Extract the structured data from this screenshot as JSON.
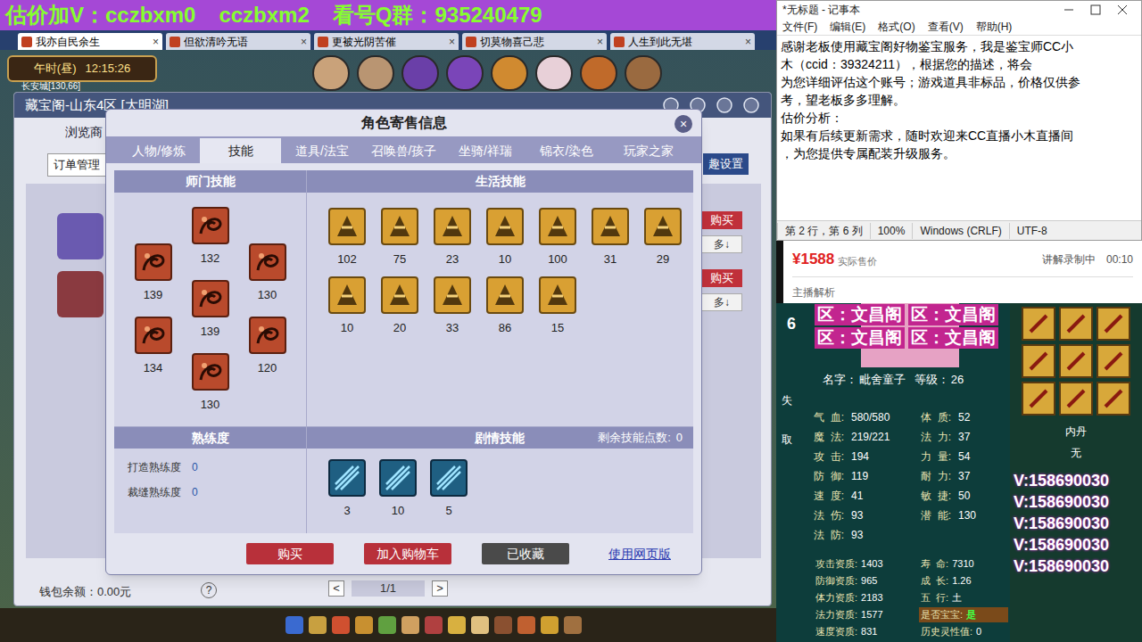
{
  "banner": {
    "label1": "估价加V：",
    "v1": "cczbxm0",
    "v2": "cczbxm2",
    "label2": "看号Q群：",
    "qq": "935240479"
  },
  "browser_tabs": [
    {
      "label": "我亦自民余生",
      "selected": true
    },
    {
      "label": "但欲清吟无语",
      "selected": false
    },
    {
      "label": "更被光阴苦催",
      "selected": false
    },
    {
      "label": "切莫物喜己悲",
      "selected": false
    },
    {
      "label": "人生到此无堪",
      "selected": false
    }
  ],
  "browser_tab_close": "×",
  "game_hud": {
    "period": "午时(昼)",
    "clock": "12:15:26",
    "location": "长安城[130,66]"
  },
  "cbg_window": {
    "title": "藏宝阁-山东4区 [大明湖]",
    "nav": "浏览商",
    "orders": "订单管理",
    "interest": "趣设置",
    "list_buttons": [
      {
        "buy": "购买",
        "more": "多↓"
      },
      {
        "buy": "购买",
        "more": "多↓"
      }
    ],
    "wallet": "钱包余额：0.00元",
    "help": "?",
    "prev": "<",
    "page": "1/1",
    "next": ">"
  },
  "dialog": {
    "title": "角色寄售信息",
    "close": "×",
    "tabs": [
      {
        "label": "人物/修炼",
        "selected": false
      },
      {
        "label": "技能",
        "selected": true
      },
      {
        "label": "道具/法宝",
        "selected": false
      },
      {
        "label": "召唤兽/孩子",
        "selected": false
      },
      {
        "label": "坐骑/祥瑞",
        "selected": false
      },
      {
        "label": "锦衣/染色",
        "selected": false
      },
      {
        "label": "玩家之家",
        "selected": false
      }
    ],
    "school_skills": {
      "title": "师门技能",
      "columns": [
        [
          "139",
          "134"
        ],
        [
          "132",
          "139",
          "130"
        ],
        [
          "130",
          "120"
        ]
      ]
    },
    "life_skills": {
      "title": "生活技能",
      "levels": [
        "102",
        "75",
        "23",
        "10",
        "100",
        "31",
        "29",
        "10",
        "20",
        "33",
        "86",
        "15"
      ]
    },
    "proficiency": {
      "title": "熟练度",
      "items": [
        {
          "label": "打造熟练度",
          "value": "0"
        },
        {
          "label": "裁缝熟练度",
          "value": "0"
        }
      ]
    },
    "plot_skills": {
      "title": "剧情技能",
      "remaining_label": "剩余技能点数:",
      "remaining": "0",
      "levels": [
        "3",
        "10",
        "5"
      ]
    },
    "buttons": [
      {
        "label": "购买",
        "kind": "primary"
      },
      {
        "label": "加入购物车",
        "kind": "primary"
      },
      {
        "label": "已收藏",
        "kind": "muted"
      },
      {
        "label": "使用网页版",
        "kind": "link"
      }
    ]
  },
  "notepad": {
    "title": "*无标题 - 记事本",
    "menu": [
      "文件(F)",
      "编辑(E)",
      "格式(O)",
      "查看(V)",
      "帮助(H)"
    ],
    "lines": [
      "感谢老板使用藏宝阁好物鉴宝服务，我是鉴宝师CC小",
      "木（ccid：39324211），根据您的描述，将会",
      "为您详细评估这个账号；游戏道具非标品，价格仅供参",
      "考，望老板多多理解。",
      "估价分析：",
      "如果有后续更新需求，随时欢迎来CC直播小木直播间",
      "，为您提供专属配装升级服务。"
    ],
    "status": [
      "第 2 行，第 6 列",
      "100%",
      "Windows (CRLF)",
      "UTF-8"
    ]
  },
  "price": {
    "amount": "¥1588",
    "label": "实际售价",
    "recording": "讲解录制中",
    "time": "00:10",
    "section": "主播解析"
  },
  "pet": {
    "index": "6",
    "region_tags": [
      "区：文昌阁",
      "区：文昌阁",
      "区：文昌阁",
      "区：文昌阁"
    ],
    "name_label": "名字：",
    "name": "毗舍童子",
    "level_label": "等级：",
    "level": "26",
    "side_chars": [
      "失",
      "取"
    ],
    "stats": [
      [
        {
          "label": "气  血:",
          "value": "580/580"
        },
        {
          "label": "体  质:",
          "value": "52"
        }
      ],
      [
        {
          "label": "魔  法:",
          "value": "219/221"
        },
        {
          "label": "法  力:",
          "value": "37"
        }
      ],
      [
        {
          "label": "攻  击:",
          "value": "194"
        },
        {
          "label": "力  量:",
          "value": "54"
        }
      ],
      [
        {
          "label": "防  御:",
          "value": "119"
        },
        {
          "label": "耐  力:",
          "value": "37"
        }
      ],
      [
        {
          "label": "速  度:",
          "value": "41"
        },
        {
          "label": "敏  捷:",
          "value": "50"
        }
      ],
      [
        {
          "label": "法  伤:",
          "value": "93"
        },
        {
          "label": "潜  能:",
          "value": "130"
        }
      ],
      [
        {
          "label": "法  防:",
          "value": "93"
        }
      ]
    ],
    "aptitudes": [
      [
        {
          "label": "攻击资质:",
          "value": "1403",
          "highlight": false
        },
        {
          "label": "寿  命:",
          "value": "7310",
          "highlight": false
        }
      ],
      [
        {
          "label": "防御资质:",
          "value": "965",
          "highlight": false
        },
        {
          "label": "成  长:",
          "value": "1.26",
          "highlight": false
        }
      ],
      [
        {
          "label": "体力资质:",
          "value": "2183",
          "highlight": false
        },
        {
          "label": "五  行:",
          "value": "土",
          "highlight": false
        }
      ],
      [
        {
          "label": "法力资质:",
          "value": "1577",
          "highlight": false
        },
        {
          "label": "是否宝宝:",
          "value": "是",
          "highlight": true
        }
      ],
      [
        {
          "label": "速度资质:",
          "value": "831",
          "highlight": false
        },
        {
          "label": "历史灵性值:",
          "value": "0",
          "highlight": false
        }
      ]
    ]
  },
  "equipment_panel": {
    "neidan_label": "内丹",
    "neidan": "无",
    "contacts": [
      "V:158690030",
      "V:158690030",
      "V:158690030",
      "V:158690030",
      "V:158690030"
    ]
  }
}
